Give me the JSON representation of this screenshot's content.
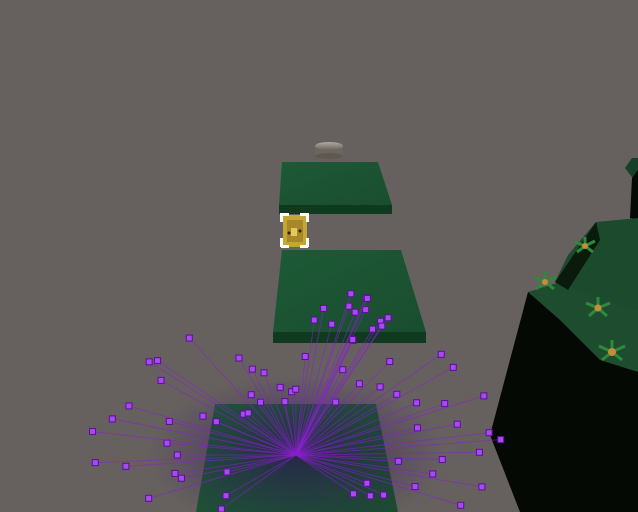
{
  "scene": {
    "description_free": true,
    "sky_color": "#66615f",
    "platform_top_color": "#1f5a37",
    "platform_side_color": "#0f3a20",
    "cliff_top_color": "#1a4a2b",
    "cliff_face_color": "#050c05",
    "particle_color": "#8a1fd0",
    "coin_color": "#8c857c",
    "character_color": "#c9ad3a"
  }
}
